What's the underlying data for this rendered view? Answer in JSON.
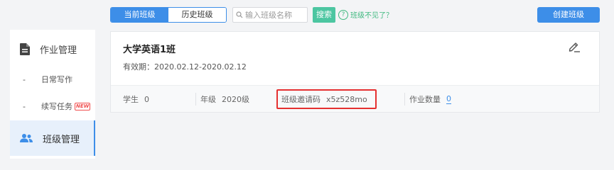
{
  "toolbar": {
    "tabs": [
      {
        "label": "当前班级",
        "active": true
      },
      {
        "label": "历史班级",
        "active": false
      }
    ],
    "search": {
      "placeholder": "输入班级名称",
      "value": ""
    },
    "search_button": "搜索",
    "help_text": "班级不见了？",
    "create_button": "创建班级"
  },
  "sidebar": {
    "homework": {
      "label": "作业管理",
      "icon": "document-icon"
    },
    "sub_items": [
      {
        "label": "日常写作"
      },
      {
        "label": "续写任务",
        "badge": "NEW"
      }
    ],
    "class_mgmt": {
      "label": "班级管理",
      "icon": "people-icon",
      "active": true
    }
  },
  "card": {
    "class_name": "大学英语1班",
    "validity": "有效期：2020.02.12-2020.02.12",
    "stats": {
      "students": {
        "label": "学生",
        "value": "0"
      },
      "grade": {
        "label": "年级",
        "value": "2020级"
      },
      "invite": {
        "label": "班级邀请码",
        "value": "x5z528mo"
      },
      "homework_count": {
        "label": "作业数量",
        "value": "0"
      }
    }
  },
  "colors": {
    "primary": "#3d8ee8",
    "success": "#4cc6a1",
    "highlight": "#e53030"
  }
}
